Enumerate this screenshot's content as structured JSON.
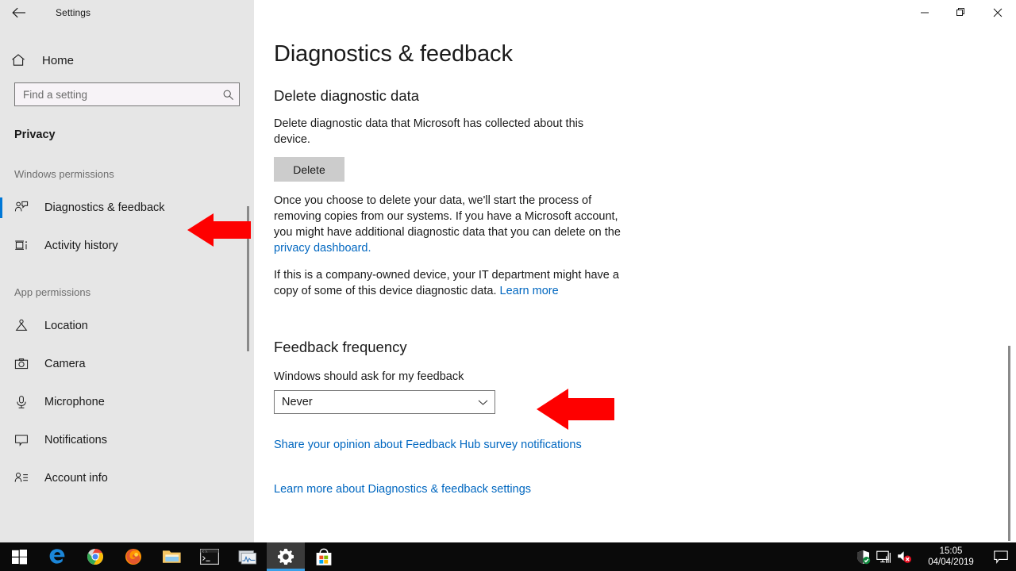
{
  "window": {
    "title": "Settings",
    "back_icon": "back-arrow-icon",
    "minimize_label": "Minimize",
    "restore_label": "Restore",
    "close_label": "Close"
  },
  "sidebar": {
    "home_label": "Home",
    "home_icon": "home-icon",
    "search": {
      "placeholder": "Find a setting",
      "value": "",
      "icon": "search-icon"
    },
    "category": "Privacy",
    "groups": [
      {
        "heading": "Windows permissions",
        "items": [
          {
            "label": "Diagnostics & feedback",
            "icon": "diagnostics-feedback-icon",
            "selected": true
          },
          {
            "label": "Activity history",
            "icon": "activity-history-icon",
            "selected": false
          }
        ]
      },
      {
        "heading": "App permissions",
        "items": [
          {
            "label": "Location",
            "icon": "location-icon",
            "selected": false
          },
          {
            "label": "Camera",
            "icon": "camera-icon",
            "selected": false
          },
          {
            "label": "Microphone",
            "icon": "microphone-icon",
            "selected": false
          },
          {
            "label": "Notifications",
            "icon": "notifications-icon",
            "selected": false
          },
          {
            "label": "Account info",
            "icon": "account-info-icon",
            "selected": false
          }
        ]
      }
    ]
  },
  "main": {
    "page_title": "Diagnostics & feedback",
    "delete_section": {
      "heading": "Delete diagnostic data",
      "description": "Delete diagnostic data that Microsoft has collected about this device.",
      "button_label": "Delete",
      "paragraph_1_before_link": "Once you choose to delete your data, we'll start the process of removing copies from our systems. If you have a Microsoft account, you might have additional diagnostic data that you can delete on the ",
      "paragraph_1_link": "privacy dashboard.",
      "paragraph_2_before_link": "If this is a company-owned device, your IT department might have a copy of some of this device diagnostic data. ",
      "paragraph_2_link": "Learn more"
    },
    "feedback_section": {
      "heading": "Feedback frequency",
      "field_label": "Windows should ask for my feedback",
      "dropdown_value": "Never",
      "dropdown_icon": "chevron-down-icon",
      "share_link": "Share your opinion about Feedback Hub survey notifications"
    },
    "footer_link": "Learn more about Diagnostics & feedback settings"
  },
  "annotations": {
    "arrow_sidebar": "red-arrow-pointing-to-diagnostics-feedback",
    "arrow_dropdown": "red-arrow-pointing-to-feedback-frequency-dropdown",
    "arrow_color": "#fe0000"
  },
  "taskbar": {
    "items": [
      {
        "name": "start-button",
        "icon": "windows-logo-icon",
        "active": false
      },
      {
        "name": "taskbar-edge",
        "icon": "microsoft-edge-icon",
        "active": false
      },
      {
        "name": "taskbar-chrome",
        "icon": "google-chrome-icon",
        "active": false
      },
      {
        "name": "taskbar-firefox",
        "icon": "firefox-icon",
        "active": false
      },
      {
        "name": "taskbar-file-explorer",
        "icon": "file-explorer-icon",
        "active": false
      },
      {
        "name": "taskbar-command-prompt",
        "icon": "command-prompt-icon",
        "active": false
      },
      {
        "name": "taskbar-task-manager",
        "icon": "task-manager-icon",
        "active": false
      },
      {
        "name": "taskbar-settings",
        "icon": "gear-icon",
        "active": true
      },
      {
        "name": "taskbar-microsoft-store",
        "icon": "microsoft-store-icon",
        "active": false
      }
    ],
    "tray": [
      {
        "name": "windows-security-icon",
        "icon": "shield-check-icon"
      },
      {
        "name": "network-icon",
        "icon": "monitor-network-icon"
      },
      {
        "name": "volume-icon",
        "icon": "speaker-muted-icon"
      }
    ],
    "clock": {
      "time": "15:05",
      "date": "04/04/2019"
    },
    "action_center_icon": "action-center-icon"
  },
  "colors": {
    "accent": "#0078d7",
    "link": "#0067c0",
    "sidebar_bg": "#e6e6e6",
    "taskbar_bg": "#0a0a0a",
    "arrow_red": "#fe0000"
  }
}
